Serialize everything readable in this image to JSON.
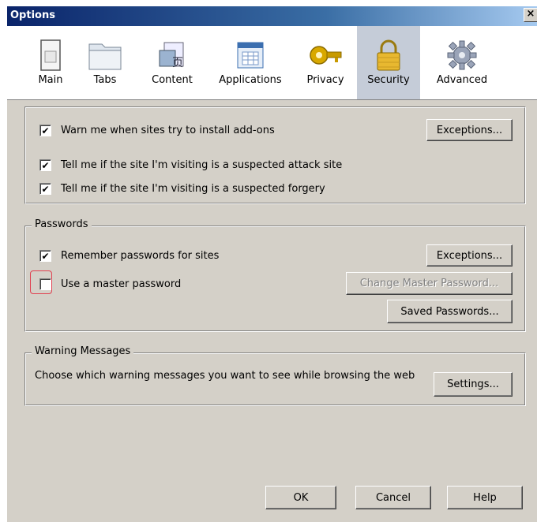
{
  "window": {
    "title": "Options",
    "close_label": "×"
  },
  "toolbar": {
    "panes": [
      {
        "label": "Main",
        "icon": "main-window-icon",
        "selected": false
      },
      {
        "label": "Tabs",
        "icon": "tabs-folder-icon",
        "selected": false
      },
      {
        "label": "Content",
        "icon": "content-page-icon",
        "selected": false
      },
      {
        "label": "Applications",
        "icon": "applications-icon",
        "selected": false
      },
      {
        "label": "Privacy",
        "icon": "privacy-key-icon",
        "selected": false
      },
      {
        "label": "Security",
        "icon": "padlock-icon",
        "selected": true
      },
      {
        "label": "Advanced",
        "icon": "gear-icon",
        "selected": false
      }
    ]
  },
  "general": {
    "warn_addons": {
      "label": "Warn me when sites try to install add-ons",
      "checked": true
    },
    "warn_addons_exceptions": "Exceptions...",
    "attack_site": {
      "label": "Tell me if the site I'm visiting is a suspected attack site",
      "checked": true
    },
    "forgery": {
      "label": "Tell me if the site I'm visiting is a suspected forgery",
      "checked": true
    }
  },
  "passwords": {
    "legend": "Passwords",
    "remember": {
      "label": "Remember passwords for sites",
      "checked": true
    },
    "exceptions": "Exceptions...",
    "master": {
      "label": "Use a master password",
      "checked": false
    },
    "change_master": "Change Master Password...",
    "saved": "Saved Passwords..."
  },
  "warnings": {
    "legend": "Warning Messages",
    "description": "Choose which warning messages you want to see while browsing the web",
    "settings": "Settings..."
  },
  "footer": {
    "ok": "OK",
    "cancel": "Cancel",
    "help": "Help"
  },
  "colors": {
    "highlight": "#e04050",
    "selected_pane": "#c5ccd8"
  }
}
